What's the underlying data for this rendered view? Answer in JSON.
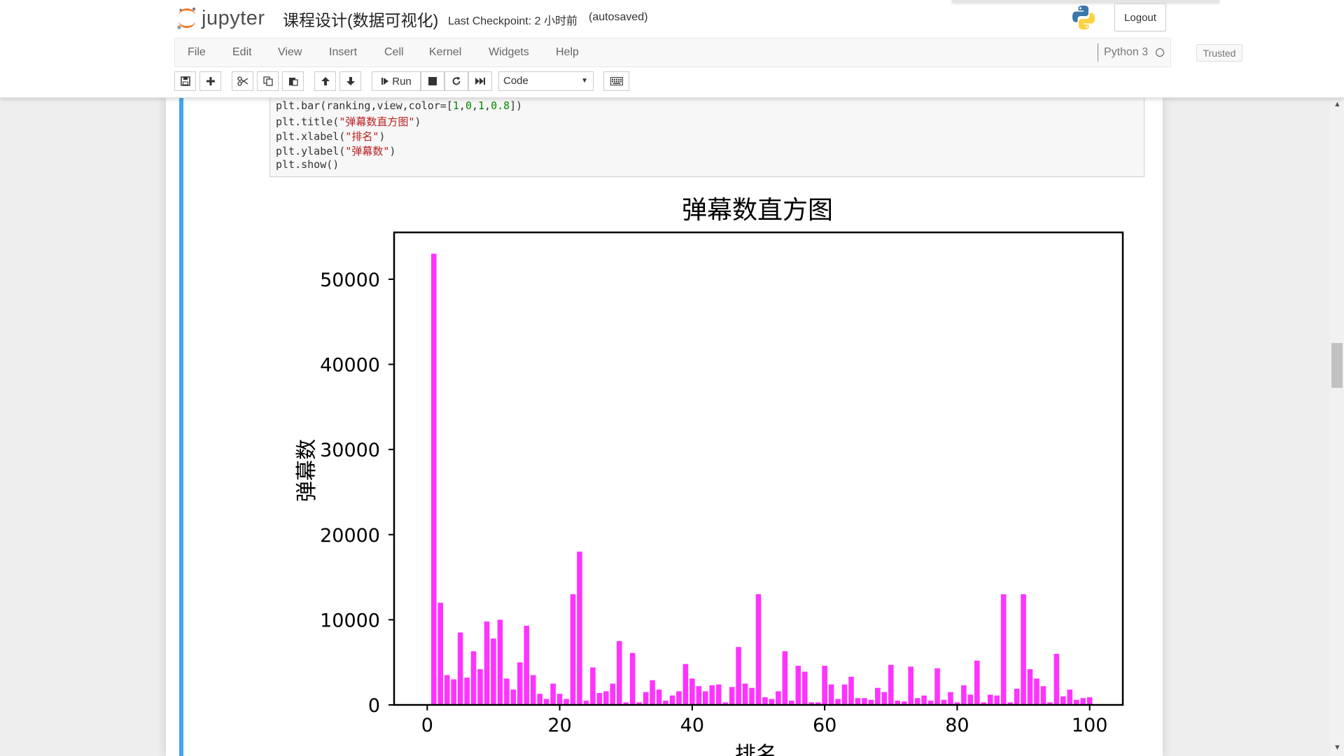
{
  "header": {
    "logo_text": "jupyter",
    "notebook_name": "课程设计(数据可视化)",
    "checkpoint": "Last Checkpoint: 2 小时前",
    "autosave": "(autosaved)",
    "logout_label": "Logout"
  },
  "menubar": {
    "items": [
      "File",
      "Edit",
      "View",
      "Insert",
      "Cell",
      "Kernel",
      "Widgets",
      "Help"
    ],
    "trusted_label": "Trusted",
    "kernel_name": "Python 3"
  },
  "toolbar": {
    "run_label": "Run",
    "cell_type": "Code",
    "icons": [
      "save-icon",
      "plus-icon",
      "cut-icon",
      "copy-icon",
      "paste-icon",
      "arrow-up-icon",
      "arrow-down-icon",
      "step-forward-icon",
      "stop-icon",
      "restart-icon",
      "fast-forward-icon",
      "keyboard-icon"
    ]
  },
  "code": {
    "lines": [
      "plt.bar(ranking,view,color=[1,0,1,0.8])",
      "plt.title(\"弹幕数直方图\")",
      "plt.xlabel(\"排名\")",
      "plt.ylabel(\"弹幕数\")",
      "plt.show()"
    ]
  },
  "colors": {
    "bar": "#ff33ff",
    "cell_bar": "#42a5f5",
    "string": "#ba2121",
    "number": "#008800"
  },
  "chart_data": {
    "type": "bar",
    "title": "弹幕数直方图",
    "xlabel": "排名",
    "ylabel": "弹幕数",
    "xlim": [
      -5,
      105
    ],
    "ylim": [
      0,
      55500
    ],
    "xticks": [
      0,
      20,
      40,
      60,
      80,
      100
    ],
    "yticks": [
      0,
      10000,
      20000,
      30000,
      40000,
      50000
    ],
    "x": [
      1,
      2,
      3,
      4,
      5,
      6,
      7,
      8,
      9,
      10,
      11,
      12,
      13,
      14,
      15,
      16,
      17,
      18,
      19,
      20,
      21,
      22,
      23,
      24,
      25,
      26,
      27,
      28,
      29,
      30,
      31,
      32,
      33,
      34,
      35,
      36,
      37,
      38,
      39,
      40,
      41,
      42,
      43,
      44,
      45,
      46,
      47,
      48,
      49,
      50,
      51,
      52,
      53,
      54,
      55,
      56,
      57,
      58,
      59,
      60,
      61,
      62,
      63,
      64,
      65,
      66,
      67,
      68,
      69,
      70,
      71,
      72,
      73,
      74,
      75,
      76,
      77,
      78,
      79,
      80,
      81,
      82,
      83,
      84,
      85,
      86,
      87,
      88,
      89,
      90,
      91,
      92,
      93,
      94,
      95,
      96,
      97,
      98,
      99,
      100
    ],
    "values": [
      53000,
      12000,
      3500,
      3000,
      8500,
      3200,
      6300,
      4200,
      9800,
      7800,
      10000,
      3100,
      1800,
      5000,
      9300,
      3500,
      1300,
      700,
      2500,
      1300,
      700,
      13000,
      18000,
      500,
      4400,
      1400,
      1600,
      2500,
      7500,
      300,
      6100,
      300,
      1500,
      2900,
      1800,
      500,
      1100,
      1600,
      4800,
      3100,
      2200,
      1600,
      2300,
      2400,
      300,
      2100,
      6800,
      2500,
      2000,
      13000,
      900,
      700,
      1600,
      6300,
      500,
      4600,
      3900,
      300,
      300,
      4600,
      2400,
      700,
      2400,
      3300,
      800,
      800,
      600,
      2000,
      1500,
      4700,
      500,
      400,
      4500,
      800,
      1100,
      500,
      4300,
      600,
      1500,
      300,
      2300,
      1200,
      5200,
      300,
      1200,
      1100,
      13000,
      300,
      1900,
      13000,
      4200,
      3100,
      2200,
      300,
      6000,
      1000,
      1800,
      600,
      800,
      900
    ]
  }
}
